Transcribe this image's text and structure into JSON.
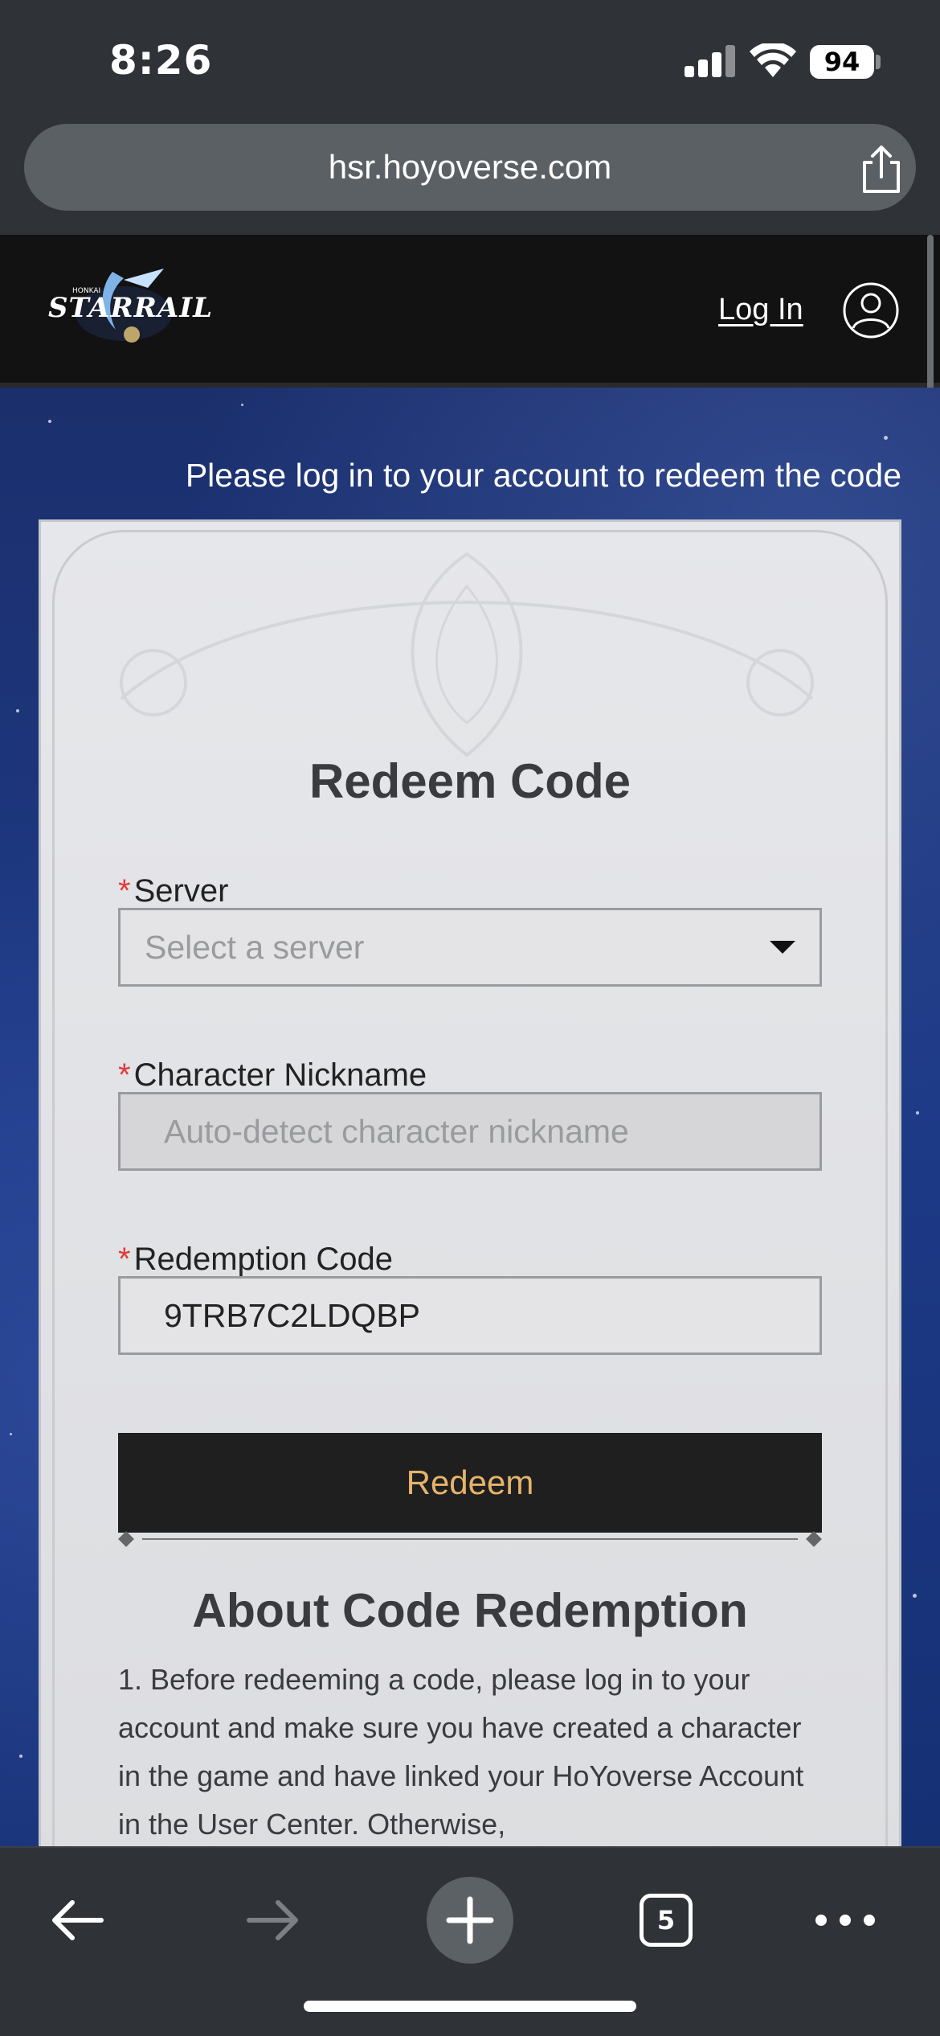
{
  "status_bar": {
    "time": "8:26",
    "battery": "94"
  },
  "browser": {
    "url": "hsr.hoyoverse.com",
    "tabs_count": "5"
  },
  "header": {
    "login_label": "Log In"
  },
  "prompt": "Please log in to your account to redeem the code",
  "form": {
    "title": "Redeem Code",
    "server": {
      "label": "Server",
      "required_mark": "*",
      "placeholder": "Select a server"
    },
    "nickname": {
      "label": "Character Nickname",
      "required_mark": "*",
      "placeholder": "Auto-detect character nickname"
    },
    "code": {
      "label": "Redemption Code",
      "required_mark": "*",
      "value": "9TRB7C2LDQBP"
    },
    "submit_label": "Redeem"
  },
  "about": {
    "title": "About Code Redemption",
    "text": "1. Before redeeming a code, please log in to your account and make sure you have created a character in the game and have linked your HoYoverse Account in the User Center. Otherwise,"
  },
  "colors": {
    "accent_button_text": "#e5b46a",
    "required": "#e3393b",
    "header_bg": "#121212"
  },
  "icons": [
    "share-icon",
    "user-icon",
    "caret-down-icon",
    "back-icon",
    "forward-icon",
    "plus-icon",
    "tabs-icon",
    "more-icon"
  ]
}
